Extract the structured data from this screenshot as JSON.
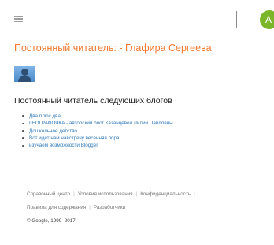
{
  "topbar": {
    "menu_icon": "hamburger-menu-icon",
    "avatar_letter": "A",
    "avatar_color": "#7bb52a"
  },
  "page_title": "Постоянный читатель: - Глафира Сергеева",
  "profile": {
    "avatar_icon": "default-user-avatar-icon"
  },
  "section_heading": "Постоянный читатель следующих блогов",
  "blogs": [
    "Два плюс два",
    "ГЕОГРАФОЧКА - авторский блог Казанцевой Лилии Павловны",
    "Дошкольное детство",
    "Вот идет нам навстречу весенняя пора!",
    "изучаем возможности Blogger"
  ],
  "footer": {
    "row1": [
      "Справочный центр",
      "Условия использования",
      "Конфиденциальность"
    ],
    "row2": [
      "Правила для содержания",
      "Разработчики"
    ],
    "copyright": "© Google, 1999–2017"
  },
  "colors": {
    "title": "#f3782f",
    "link": "#2f78b8",
    "footer_text": "#757575"
  }
}
